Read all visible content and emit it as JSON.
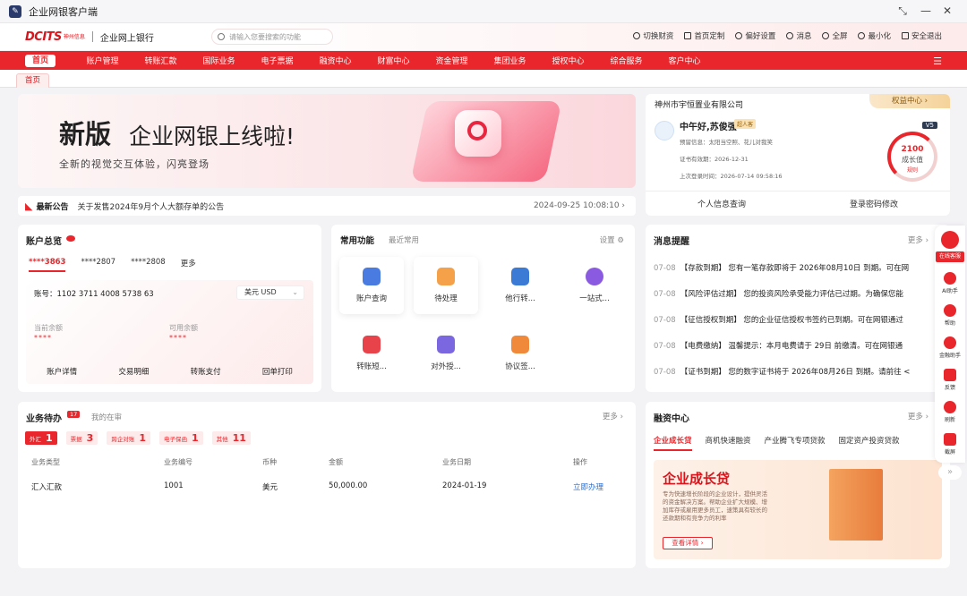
{
  "window": {
    "title": "企业网银客户端",
    "controls": [
      "⤡",
      "—",
      "✕"
    ]
  },
  "header": {
    "logo_text": "DCITS",
    "logo_sub": "神州信息",
    "bank_name": "企业网上银行",
    "search_placeholder": "请输入您要搜索的功能",
    "tools": [
      "切换财资",
      "首页定制",
      "偏好设置",
      "消息",
      "全屏",
      "最小化",
      "安全退出"
    ]
  },
  "nav": {
    "items": [
      "首页",
      "账户管理",
      "转账汇款",
      "国际业务",
      "电子票据",
      "融资中心",
      "财富中心",
      "资金管理",
      "集团业务",
      "授权中心",
      "综合服务",
      "客户中心"
    ],
    "active": "首页"
  },
  "tabs": [
    "首页"
  ],
  "banner": {
    "title_bold": "新版",
    "title_rest": "企业网银上线啦!",
    "subtitle": "全新的视觉交互体验，闪亮登场"
  },
  "notice": {
    "label": "最新公告",
    "text": "关于发售2024年9月个人大额存单的公告",
    "date": "2024-09-25 10:08:10 ›"
  },
  "profile": {
    "company": "神州市宇恒置业有限公司",
    "rights": "权益中心 ›",
    "greeting": "中午好,苏俊强",
    "tag": "超人客",
    "info_label": "预留信息：",
    "info_value": "太阳当空照、花儿对我笑",
    "cert_label": "证书有效期：",
    "cert_value": "2026-12-31",
    "login_label": "上次登录时间：",
    "login_value": "2026-07-14 09:58:16",
    "level": "V5",
    "growth_value": "2100",
    "growth_label": "成长值",
    "growth_rule": "规则",
    "growth_progress": 0.7,
    "footer": [
      "个人信息查询",
      "登录密码修改"
    ]
  },
  "accounts": {
    "title": "账户总览",
    "tabs": [
      "****3863",
      "****2807",
      "****2808",
      "更多"
    ],
    "account_label": "账号：",
    "account_no": "1102 3711 4008 5738 63",
    "currency": "美元 USD",
    "current_label": "当前余额",
    "current_value": "****",
    "available_label": "可用余额",
    "available_value": "****",
    "actions": [
      "账户详情",
      "交易明细",
      "转账支付",
      "回单打印"
    ]
  },
  "functions": {
    "tab_active": "常用功能",
    "tab_other": "最近常用",
    "settings": "设置 ⚙",
    "items": [
      {
        "label": "账户查询",
        "color": "#4a7be0"
      },
      {
        "label": "待处理",
        "color": "#f4a14a"
      },
      {
        "label": "他行转...",
        "color": "#3b7bd6"
      },
      {
        "label": "一站式...",
        "color": "#8a5be0"
      },
      {
        "label": "转账短...",
        "color": "#e8434a"
      },
      {
        "label": "对外授...",
        "color": "#7b68e0"
      },
      {
        "label": "协议签...",
        "color": "#f08a3a"
      }
    ]
  },
  "messages": {
    "title": "消息提醒",
    "more": "更多 ›",
    "items": [
      {
        "date": "07-08",
        "text": "【存款到期】 您有一笔存款即将于 2026年08月10日 到期。可在网"
      },
      {
        "date": "07-08",
        "text": "【风险评估过期】 您的投资风险承受能力评估已过期。为确保您能"
      },
      {
        "date": "07-08",
        "text": "【征信授权到期】 您的企业征信授权书签约已到期。可在网银通过"
      },
      {
        "date": "07-08",
        "text": "【电费缴纳】 温馨提示：本月电费请于 29日 前缴清。可在网银通"
      },
      {
        "date": "07-08",
        "text": "【证书到期】 您的数字证书将于 2026年08月26日 到期。请前往 <"
      }
    ]
  },
  "todo": {
    "title": "业务待办",
    "count": "17",
    "tab2": "我的在审",
    "more": "更多 ›",
    "chips": [
      {
        "label": "外汇",
        "count": "1"
      },
      {
        "label": "票据",
        "count": "3"
      },
      {
        "label": "跨企对账",
        "count": "1"
      },
      {
        "label": "电子保函",
        "count": "1"
      },
      {
        "label": "其他",
        "count": "11"
      }
    ],
    "columns": [
      "业务类型",
      "业务编号",
      "币种",
      "金额",
      "业务日期",
      "操作"
    ],
    "rows": [
      {
        "type": "汇入汇款",
        "no": "1001",
        "currency": "美元",
        "amount": "50,000.00",
        "date": "2024-01-19",
        "action": "立即办理"
      }
    ]
  },
  "finance": {
    "title": "融资中心",
    "more": "更多 ›",
    "tabs": [
      "企业成长贷",
      "商机快速融资",
      "产业腾飞专项贷款",
      "固定资产投资贷款"
    ],
    "product_title": "企业成长贷",
    "product_desc": "专为快速增长阶段的企业设计，提供灵活的资金解决方案。帮助企业扩大规模、增加库存或雇用更多员工，速策具有较长的还款期和有竞争力的利率",
    "product_button": "查看详情 ›"
  },
  "rail": {
    "items": [
      "在线客服",
      "AI助手",
      "帮助",
      "金融助手",
      "反馈",
      "刷新",
      "截屏"
    ],
    "collapse": "»"
  }
}
